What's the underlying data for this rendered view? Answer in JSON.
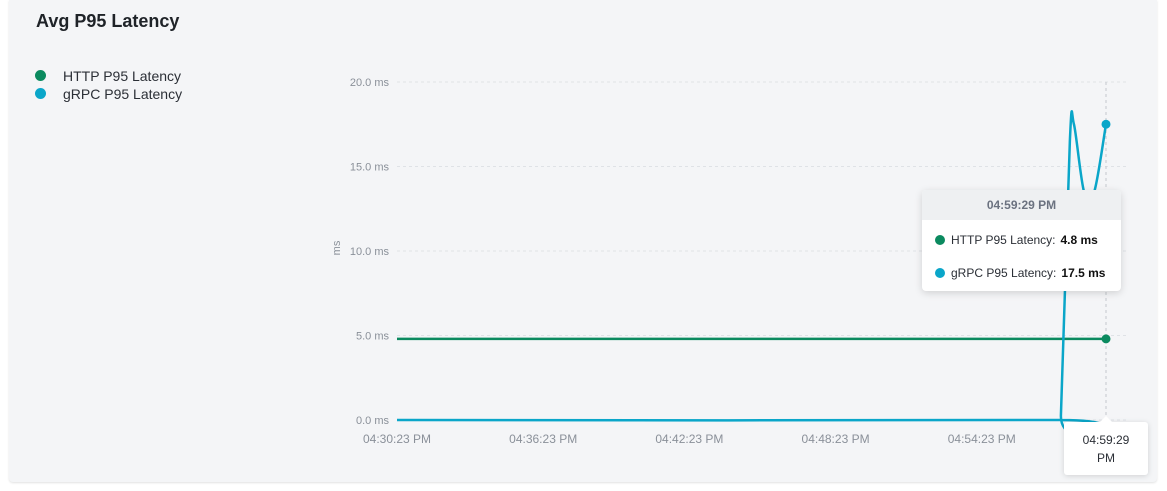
{
  "panel": {
    "title": "Avg P95 Latency"
  },
  "legend": {
    "items": [
      {
        "label": "HTTP P95 Latency",
        "color": "#0b8a5f"
      },
      {
        "label": "gRPC P95 Latency",
        "color": "#0aa6c9"
      }
    ]
  },
  "tooltip": {
    "time": "04:59:29 PM",
    "rows": [
      {
        "label": "HTTP P95 Latency:",
        "value": "4.8 ms",
        "color": "#0b8a5f"
      },
      {
        "label": "gRPC P95 Latency:",
        "value": "17.5 ms",
        "color": "#0aa6c9"
      }
    ]
  },
  "x_tooltip": {
    "line1": "04:59:29",
    "line2": "PM"
  },
  "chart_data": {
    "type": "line",
    "ylabel": "ms",
    "ylim": [
      0,
      20
    ],
    "yticks": [
      0,
      5,
      10,
      15,
      20
    ],
    "ytick_labels": [
      "0.0 ms",
      "5.0 ms",
      "10.0 ms",
      "15.0 ms",
      "20.0 ms"
    ],
    "xlim": [
      "04:30:23 PM",
      "04:59:29 PM"
    ],
    "xticks": [
      "04:30:23 PM",
      "04:36:23 PM",
      "04:42:23 PM",
      "04:48:23 PM",
      "04:54:23 PM"
    ],
    "grid": true,
    "legend_position": "top-left",
    "hover_x": "04:59:29 PM",
    "series": [
      {
        "name": "HTTP P95 Latency",
        "color": "#0b8a5f",
        "points": [
          [
            "04:30:23 PM",
            4.8
          ],
          [
            "04:56:00 PM",
            4.8
          ],
          [
            "04:59:29 PM",
            4.8
          ]
        ]
      },
      {
        "name": "gRPC P95 Latency",
        "color": "#0aa6c9",
        "points": [
          [
            "04:30:23 PM",
            0
          ],
          [
            "04:57:30 PM",
            0
          ],
          [
            "04:57:38 PM",
            0.3
          ],
          [
            "04:58:00 PM",
            16.5
          ],
          [
            "04:58:10 PM",
            17.5
          ],
          [
            "04:58:35 PM",
            13.5
          ],
          [
            "04:59:00 PM",
            13.5
          ],
          [
            "04:59:29 PM",
            17.5
          ]
        ]
      }
    ]
  }
}
